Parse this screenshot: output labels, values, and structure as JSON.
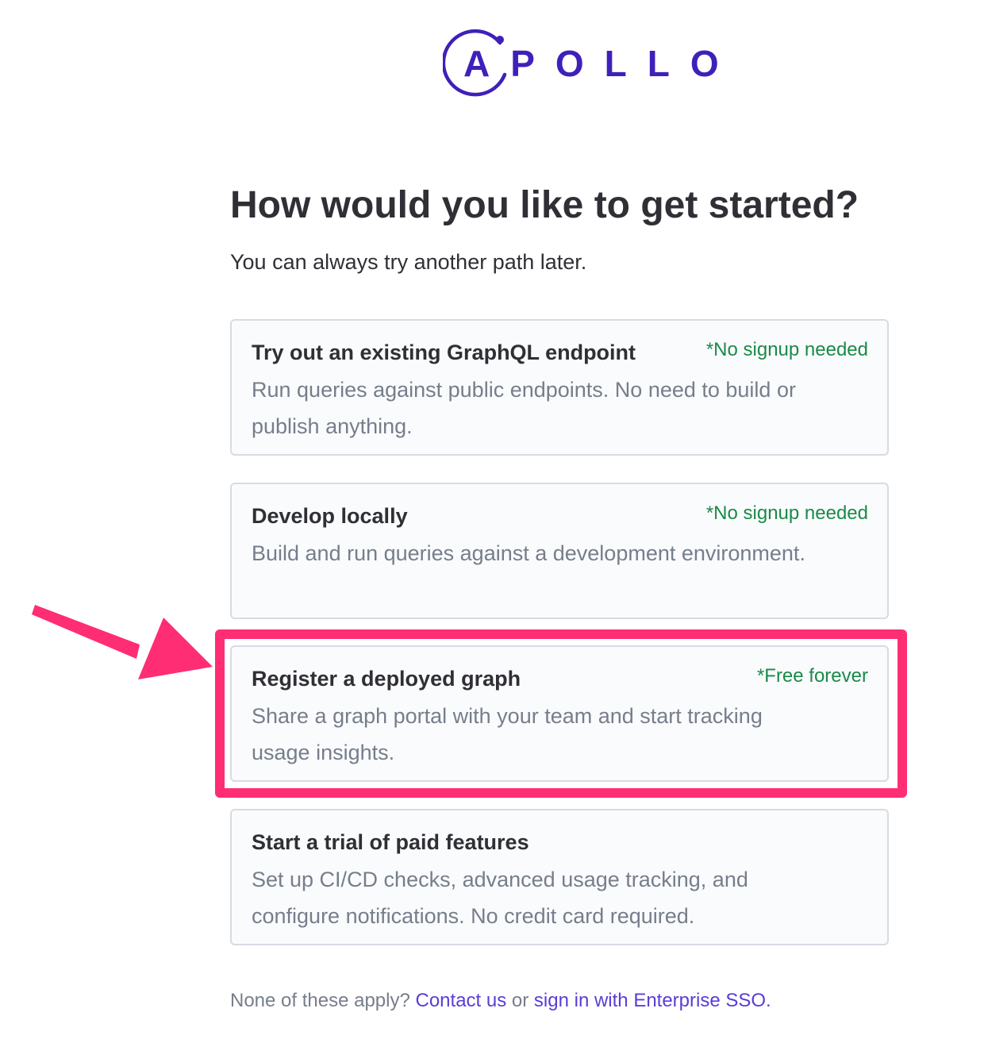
{
  "logo": {
    "text": "APOLLO",
    "color": "#3f20ba"
  },
  "header": {
    "title": "How would you like to get started?",
    "subtitle": "You can always try another path later."
  },
  "options": [
    {
      "title": "Try out an existing GraphQL endpoint",
      "badge": "*No signup needed",
      "description": "Run queries against public endpoints. No need to build or publish anything."
    },
    {
      "title": "Develop locally",
      "badge": "*No signup needed",
      "description": "Build and run queries against a development environment."
    },
    {
      "title": "Register a deployed graph",
      "badge": "*Free forever",
      "description": "Share a graph portal with your team and start tracking usage insights."
    },
    {
      "title": "Start a trial of paid features",
      "badge": "",
      "description": "Set up CI/CD checks, advanced usage tracking, and configure notifications. No credit card required."
    }
  ],
  "footer": {
    "prefix": "None of these apply?",
    "contact_link": "Contact us",
    "middle": "or",
    "sso_link": "sign in with Enterprise SSO",
    "suffix": "."
  },
  "colors": {
    "highlight": "#ff2d73",
    "badge": "#1a8a4a",
    "link": "#5a3dd6"
  }
}
